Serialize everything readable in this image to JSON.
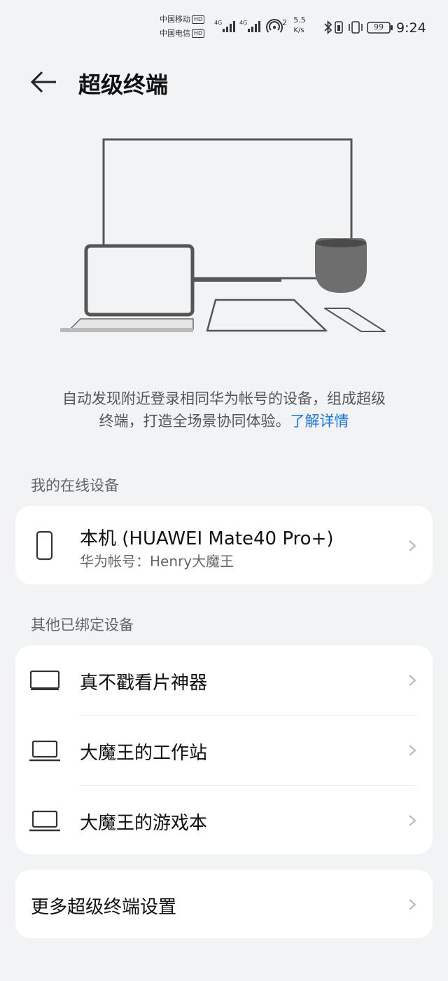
{
  "status_bar": {
    "carrier1": "中国移动",
    "carrier2": "中国电信",
    "hd_label": "HD",
    "net_type_1": "4G",
    "net_type_2": "4G",
    "hotspot_count": "2",
    "speed_value": "5.5",
    "speed_unit": "K/s",
    "battery": "99",
    "time": "9:24"
  },
  "header": {
    "title": "超级终端"
  },
  "description": {
    "line1": "自动发现附近登录相同华为帐号的设备，组成超级",
    "line2": "终端，打造全场景协同体验。",
    "link": "了解详情"
  },
  "my_devices": {
    "section_title": "我的在线设备",
    "device_name": "本机 (HUAWEI Mate40 Pro+)",
    "account_line": "华为帐号：Henry大魔王"
  },
  "bound_devices": {
    "section_title": "其他已绑定设备",
    "items": [
      {
        "label": "真不戳看片神器",
        "icon": "tablet-landscape-icon"
      },
      {
        "label": "大魔王的工作站",
        "icon": "laptop-icon"
      },
      {
        "label": "大魔王的游戏本",
        "icon": "laptop-icon"
      }
    ]
  },
  "more_settings": {
    "label": "更多超级终端设置"
  },
  "colors": {
    "background": "#f1f3f5",
    "card": "#ffffff",
    "link": "#1a73e8"
  }
}
